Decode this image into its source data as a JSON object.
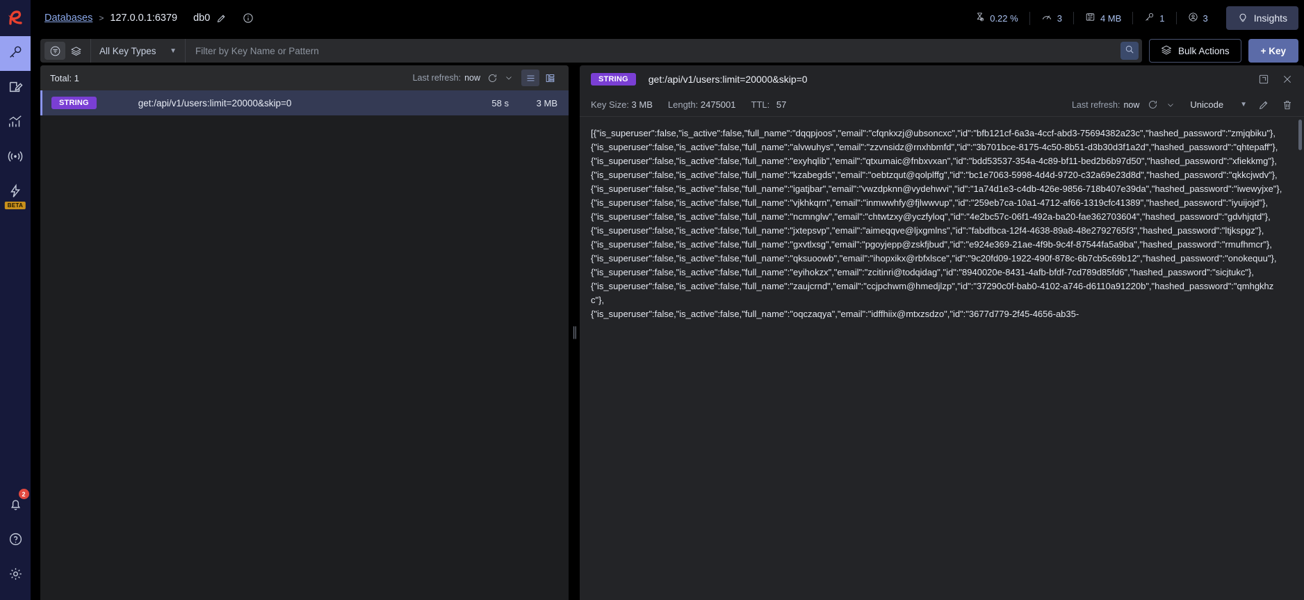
{
  "rail": {
    "logo_icon": "redis-logo-icon",
    "items": [
      {
        "name": "browser",
        "icon": "key-icon",
        "active": true
      },
      {
        "name": "workbench",
        "icon": "edit-document-icon",
        "active": false
      },
      {
        "name": "analysis-tools",
        "icon": "bar-chart-icon",
        "active": false
      },
      {
        "name": "pubsub",
        "icon": "broadcast-icon",
        "active": false
      },
      {
        "name": "triggers-and-functions",
        "icon": "lightning-gear-icon",
        "active": false,
        "badge": "BETA"
      }
    ],
    "bottom": [
      {
        "name": "notifications",
        "icon": "bell-icon",
        "badge": "2"
      },
      {
        "name": "help",
        "icon": "question-circle-icon"
      },
      {
        "name": "settings",
        "icon": "gear-icon"
      }
    ]
  },
  "header": {
    "breadcrumb": {
      "databases_label": "Databases",
      "separator": ">",
      "host": "127.0.0.1:6379",
      "db_index": "db0",
      "edit_icon": "pencil-icon",
      "info_icon": "info-circle-icon"
    },
    "metrics": [
      {
        "name": "cpu",
        "icon": "hourglass-icon",
        "value": "0.22 %"
      },
      {
        "name": "commands-per-second",
        "icon": "speedometer-icon",
        "value": "3"
      },
      {
        "name": "memory",
        "icon": "database-chip-icon",
        "value": "4 MB"
      },
      {
        "name": "total-keys",
        "icon": "key-icon",
        "value": "1"
      },
      {
        "name": "connected-clients",
        "icon": "user-circle-icon",
        "value": "3"
      }
    ],
    "insights": {
      "label": "Insights",
      "icon": "lightbulb-icon"
    }
  },
  "filterbar": {
    "filter_icon": "filter-funnel-icon",
    "scan_icon": "layers-icon",
    "key_type": {
      "label": "All Key Types",
      "chevron_icon": "chevron-down-icon"
    },
    "search": {
      "value": "",
      "placeholder": "Filter by Key Name or Pattern",
      "icon": "search-icon"
    },
    "bulk_actions": {
      "label": "Bulk Actions",
      "icon": "layers-stack-icon"
    },
    "add_key": {
      "label": "+ Key"
    }
  },
  "keys_panel": {
    "total_label": "Total: 1",
    "last_refresh_label": "Last refresh:",
    "last_refresh_value": "now",
    "refresh_icon": "refresh-icon",
    "refresh_chevron_icon": "chevron-down-icon",
    "view_list_icon": "list-view-icon",
    "view_tree_icon": "tree-view-icon",
    "rows": [
      {
        "type": "STRING",
        "name": "get:/api/v1/users:limit=20000&skip=0",
        "ttl": "58 s",
        "size": "3 MB"
      }
    ]
  },
  "details": {
    "type_badge": "STRING",
    "key_name": "get:/api/v1/users:limit=20000&skip=0",
    "fullscreen_icon": "expand-icon",
    "close_icon": "close-icon",
    "meta": {
      "key_size_label": "Key Size:",
      "key_size_value": "3 MB",
      "length_label": "Length:",
      "length_value": "2475001",
      "ttl_label": "TTL:",
      "ttl_value": "57",
      "last_refresh_label": "Last refresh:",
      "last_refresh_value": "now",
      "refresh_icon": "refresh-icon",
      "refresh_chevron_icon": "chevron-down-icon",
      "format_label": "Unicode",
      "format_chevron_icon": "chevron-down-icon",
      "edit_icon": "pencil-icon",
      "delete_icon": "trash-icon"
    },
    "value": "[{\"is_superuser\":false,\"is_active\":false,\"full_name\":\"dqqpjoos\",\"email\":\"cfqnkxzj@ubsoncxc\",\"id\":\"bfb121cf-6a3a-4ccf-abd3-75694382a23c\",\"hashed_password\":\"zmjqbiku\"},\n{\"is_superuser\":false,\"is_active\":false,\"full_name\":\"alvwuhys\",\"email\":\"zzvnsidz@rnxhbmfd\",\"id\":\"3b701bce-8175-4c50-8b51-d3b30d3f1a2d\",\"hashed_password\":\"qhtepaff\"},\n{\"is_superuser\":false,\"is_active\":false,\"full_name\":\"exyhqlib\",\"email\":\"qtxumaic@fnbxvxan\",\"id\":\"bdd53537-354a-4c89-bf11-bed2b6b97d50\",\"hashed_password\":\"xfiekkmg\"},\n{\"is_superuser\":false,\"is_active\":false,\"full_name\":\"kzabegds\",\"email\":\"oebtzqut@qolplffg\",\"id\":\"bc1e7063-5998-4d4d-9720-c32a69e23d8d\",\"hashed_password\":\"qkkcjwdv\"},\n{\"is_superuser\":false,\"is_active\":false,\"full_name\":\"igatjbar\",\"email\":\"vwzdpknn@vydehwvi\",\"id\":\"1a74d1e3-c4db-426e-9856-718b407e39da\",\"hashed_password\":\"iwewyjxe\"},\n{\"is_superuser\":false,\"is_active\":false,\"full_name\":\"vjkhkqrn\",\"email\":\"inmwwhfy@fjlwwvup\",\"id\":\"259eb7ca-10a1-4712-af66-1319cfc41389\",\"hashed_password\":\"iyuijojd\"},\n{\"is_superuser\":false,\"is_active\":false,\"full_name\":\"ncmnglw\",\"email\":\"chtwtzxy@yczfyloq\",\"id\":\"4e2bc57c-06f1-492a-ba20-fae362703604\",\"hashed_password\":\"gdvhjqtd\"},\n{\"is_superuser\":false,\"is_active\":false,\"full_name\":\"jxtepsvp\",\"email\":\"aimeqqve@ljxgmlns\",\"id\":\"fabdfbca-12f4-4638-89a8-48e2792765f3\",\"hashed_password\":\"ltjkspgz\"},\n{\"is_superuser\":false,\"is_active\":false,\"full_name\":\"gxvtlxsg\",\"email\":\"pgoyjepp@zskfjbud\",\"id\":\"e924e369-21ae-4f9b-9c4f-87544fa5a9ba\",\"hashed_password\":\"rmufhmcr\"},\n{\"is_superuser\":false,\"is_active\":false,\"full_name\":\"qksuoowb\",\"email\":\"ihopxikx@rbfxlsce\",\"id\":\"9c20fd09-1922-490f-878c-6b7cb5c69b12\",\"hashed_password\":\"onokequu\"},\n{\"is_superuser\":false,\"is_active\":false,\"full_name\":\"eyihokzx\",\"email\":\"zcitinri@todqidag\",\"id\":\"8940020e-8431-4afb-bfdf-7cd789d85fd6\",\"hashed_password\":\"sicjtukc\"},\n{\"is_superuser\":false,\"is_active\":false,\"full_name\":\"zaujcrnd\",\"email\":\"ccjpchwm@hmedjlzp\",\"id\":\"37290c0f-bab0-4102-a746-d6110a91220b\",\"hashed_password\":\"qmhgkhzc\"},\n{\"is_superuser\":false,\"is_active\":false,\"full_name\":\"oqczaqya\",\"email\":\"idffhiix@mtxzsdzo\",\"id\":\"3677d779-2f45-4656-ab35-"
  }
}
